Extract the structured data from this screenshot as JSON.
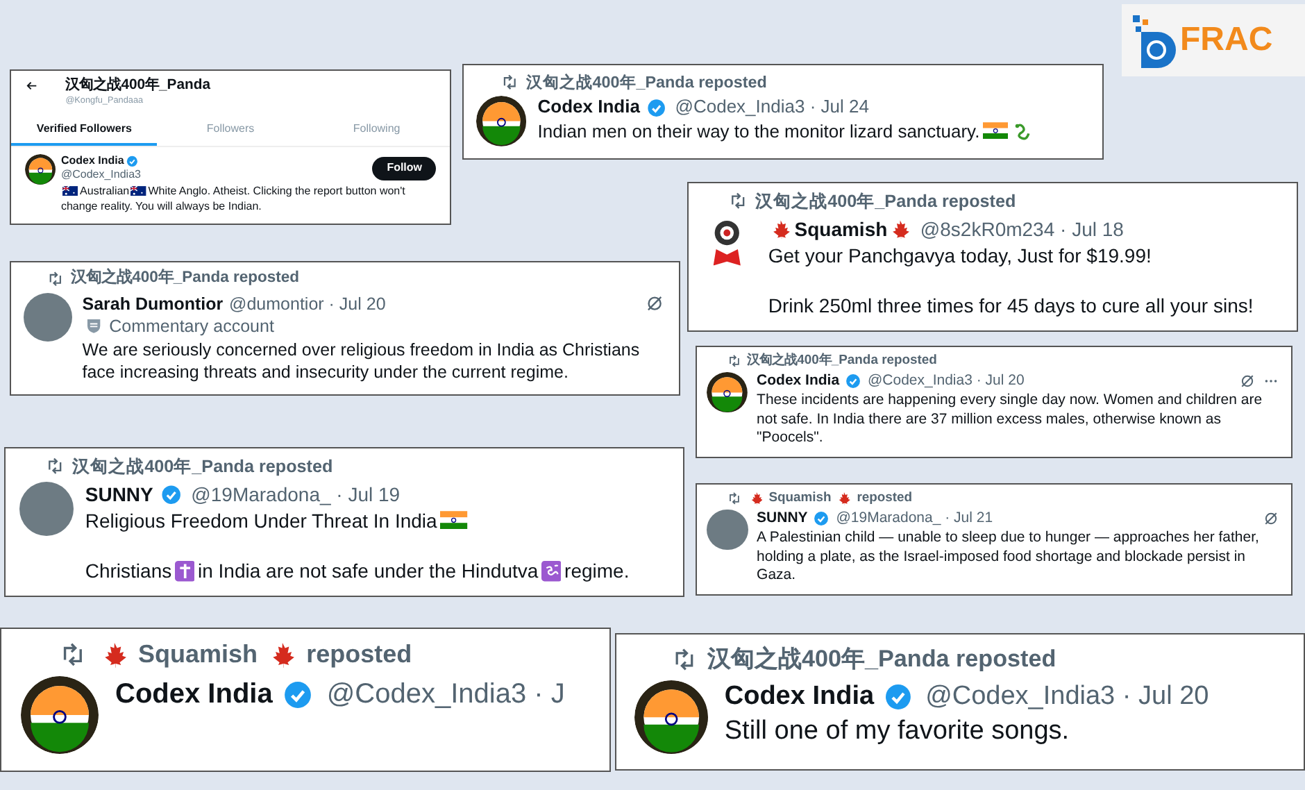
{
  "logo": {
    "text": "FRAC"
  },
  "cards": [
    {
      "kind": "profile",
      "title": "汉匈之战400年_Panda",
      "handle": "@Kongfu_Pandaaa",
      "tabs": [
        {
          "label": "Verified Followers",
          "selected": true
        },
        {
          "label": "Followers",
          "selected": false
        },
        {
          "label": "Following",
          "selected": false
        }
      ],
      "user": {
        "name": "Codex India",
        "verified": true,
        "handle": "@Codex_India3",
        "button": "Follow",
        "bio_lines": [
          [
            {
              "kind": "flag-au"
            },
            {
              "kind": "text",
              "text": "Australian"
            },
            {
              "kind": "flag-au"
            },
            {
              "kind": "text",
              "text": "White Anglo. Atheist. Clicking the report button won't"
            }
          ],
          [
            {
              "kind": "text",
              "text": "change reality. You will always be Indian."
            }
          ]
        ]
      }
    },
    {
      "kind": "tweet",
      "reposter": [
        {
          "kind": "text",
          "text": "汉匈之战400年_Panda reposted"
        }
      ],
      "author": [
        {
          "kind": "text",
          "text": "Codex India"
        }
      ],
      "verified": true,
      "meta": "@Codex_India3 · Jul 24",
      "body": [
        [
          {
            "kind": "text",
            "text": "Indian men on their way to the monitor lizard sanctuary."
          },
          {
            "kind": "flag-in"
          },
          {
            "kind": "lizard"
          }
        ]
      ]
    },
    {
      "kind": "tweet",
      "reposter": [
        {
          "kind": "text",
          "text": "汉匈之战400年_Panda reposted"
        }
      ],
      "author": [
        {
          "kind": "leaf"
        },
        {
          "kind": "text",
          "text": "Squamish"
        },
        {
          "kind": "leaf"
        }
      ],
      "verified": false,
      "meta": "@8s2kR0m234 · Jul 18",
      "body": [
        [
          {
            "kind": "text",
            "text": "Get your Panchgavya today, Just for $19.99!"
          }
        ],
        [
          {
            "kind": "text",
            "text": "Drink 250ml three times for 45 days to cure all your sins!"
          }
        ]
      ]
    },
    {
      "kind": "tweet",
      "reposter": [
        {
          "kind": "text",
          "text": "汉匈之战400年_Panda reposted"
        }
      ],
      "author": [
        {
          "kind": "text",
          "text": "Sarah Dumontior"
        }
      ],
      "verified": false,
      "meta": "@dumontior · Jul 20",
      "label": "Commentary account",
      "body": [
        [
          {
            "kind": "text",
            "text": "We are seriously concerned over religious freedom in India as Christians face increasing threats and insecurity under the current regime."
          }
        ]
      ]
    },
    {
      "kind": "tweet",
      "reposter": [
        {
          "kind": "text",
          "text": "汉匈之战400年_Panda reposted"
        }
      ],
      "author": [
        {
          "kind": "text",
          "text": "Codex India"
        }
      ],
      "verified": true,
      "meta": "@Codex_India3 · Jul 20",
      "body": [
        [
          {
            "kind": "text",
            "text": "These incidents are happening every single day now. Women and children are not safe. In India there are 37 million excess males, otherwise known as \"Poocels\"."
          }
        ]
      ]
    },
    {
      "kind": "tweet",
      "reposter": [
        {
          "kind": "text",
          "text": "汉匈之战400年_Panda reposted"
        }
      ],
      "author": [
        {
          "kind": "text",
          "text": "SUNNY"
        }
      ],
      "verified": true,
      "meta": "@19Maradona_ · Jul 19",
      "body": [
        [
          {
            "kind": "text",
            "text": "Religious Freedom Under Threat In India"
          },
          {
            "kind": "flag-in"
          }
        ],
        [
          {
            "kind": "text",
            "text": "Christians"
          },
          {
            "kind": "cross"
          },
          {
            "kind": "text",
            "text": "in India are not safe under the Hindutva"
          },
          {
            "kind": "om"
          },
          {
            "kind": "text",
            "text": "regime."
          }
        ]
      ]
    },
    {
      "kind": "tweet",
      "reposter": [
        {
          "kind": "leaf"
        },
        {
          "kind": "text",
          "text": "Squamish"
        },
        {
          "kind": "leaf"
        },
        {
          "kind": "text",
          "text": "reposted"
        }
      ],
      "author": [
        {
          "kind": "text",
          "text": "SUNNY"
        }
      ],
      "verified": true,
      "meta": "@19Maradona_ · Jul 21",
      "body": [
        [
          {
            "kind": "text",
            "text": "A Palestinian child — unable to sleep due to hunger — approaches her father, holding a plate, as the Israel-imposed food shortage and blockade persist in Gaza."
          }
        ]
      ]
    },
    {
      "kind": "tweet",
      "reposter": [
        {
          "kind": "leaf"
        },
        {
          "kind": "text",
          "text": "Squamish"
        },
        {
          "kind": "leaf"
        },
        {
          "kind": "text",
          "text": "reposted"
        }
      ],
      "author": [
        {
          "kind": "text",
          "text": "Codex India"
        }
      ],
      "verified": true,
      "meta": "@Codex_India3 · J"
    },
    {
      "kind": "tweet",
      "reposter": [
        {
          "kind": "text",
          "text": "汉匈之战400年_Panda reposted"
        }
      ],
      "author": [
        {
          "kind": "text",
          "text": "Codex India"
        }
      ],
      "verified": true,
      "meta": "@Codex_India3 · Jul 20",
      "body": [
        [
          {
            "kind": "text",
            "text": "Still one of my favorite songs."
          }
        ]
      ]
    }
  ]
}
